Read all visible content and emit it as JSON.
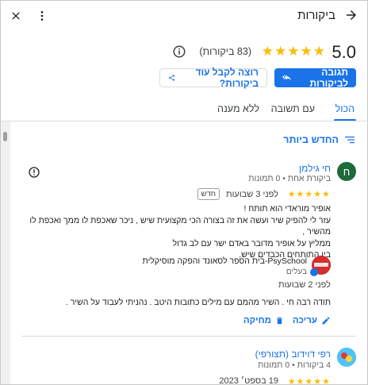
{
  "header": {
    "title": "ביקורות"
  },
  "summary": {
    "rating": "5.0",
    "stars": "★★★★★",
    "count": "(83 ביקורות)"
  },
  "actions": {
    "reply_label": "תגובה לביקורות",
    "request_label": "רוצה לקבל עוד ביקורות?"
  },
  "tabs": [
    {
      "label": "הכול"
    },
    {
      "label": "עם תשובה"
    },
    {
      "label": "ללא מענה"
    }
  ],
  "sort": {
    "label": "החדש ביותר"
  },
  "reviews": [
    {
      "initial": "ח",
      "avatar_color": "#1e6b3a",
      "name": "חי גילמן",
      "meta": "ביקורת אחת • 0 תמונות",
      "stars": "★★★★★",
      "date": "לפני 3 שבועות",
      "badge": "חדש",
      "text": [
        "אופיר מוראדי הוא תותח !",
        "עזר לי להפיק שיר ועשה את זה בצורה הכי מקצועית שיש , ניכר שאכפת לו ממך ואכפת לו מהשיר ,",
        "ממליץ על אופיר מדובר באדם ישר עם לב גדול",
        "בין התותחים הכבדים שיש."
      ],
      "owner_reply": {
        "name": "PsySchool-בית הספר לסאונד והפקה מוסיקלית",
        "role": "בעלים",
        "date": "לפני 2 שבועות",
        "text": "תודה רבה חי . השיר מהמם עם מילים כתובות היטב . נהניתי לעבוד על השיר .",
        "edit_label": "עריכה",
        "delete_label": "מחיקה"
      }
    },
    {
      "name": "רפי דוידוב (תצורפי)",
      "meta": "4 ביקורות • 0 תמונות",
      "stars": "★★★★★",
      "date": "19 בספט׳ 2023"
    }
  ]
}
